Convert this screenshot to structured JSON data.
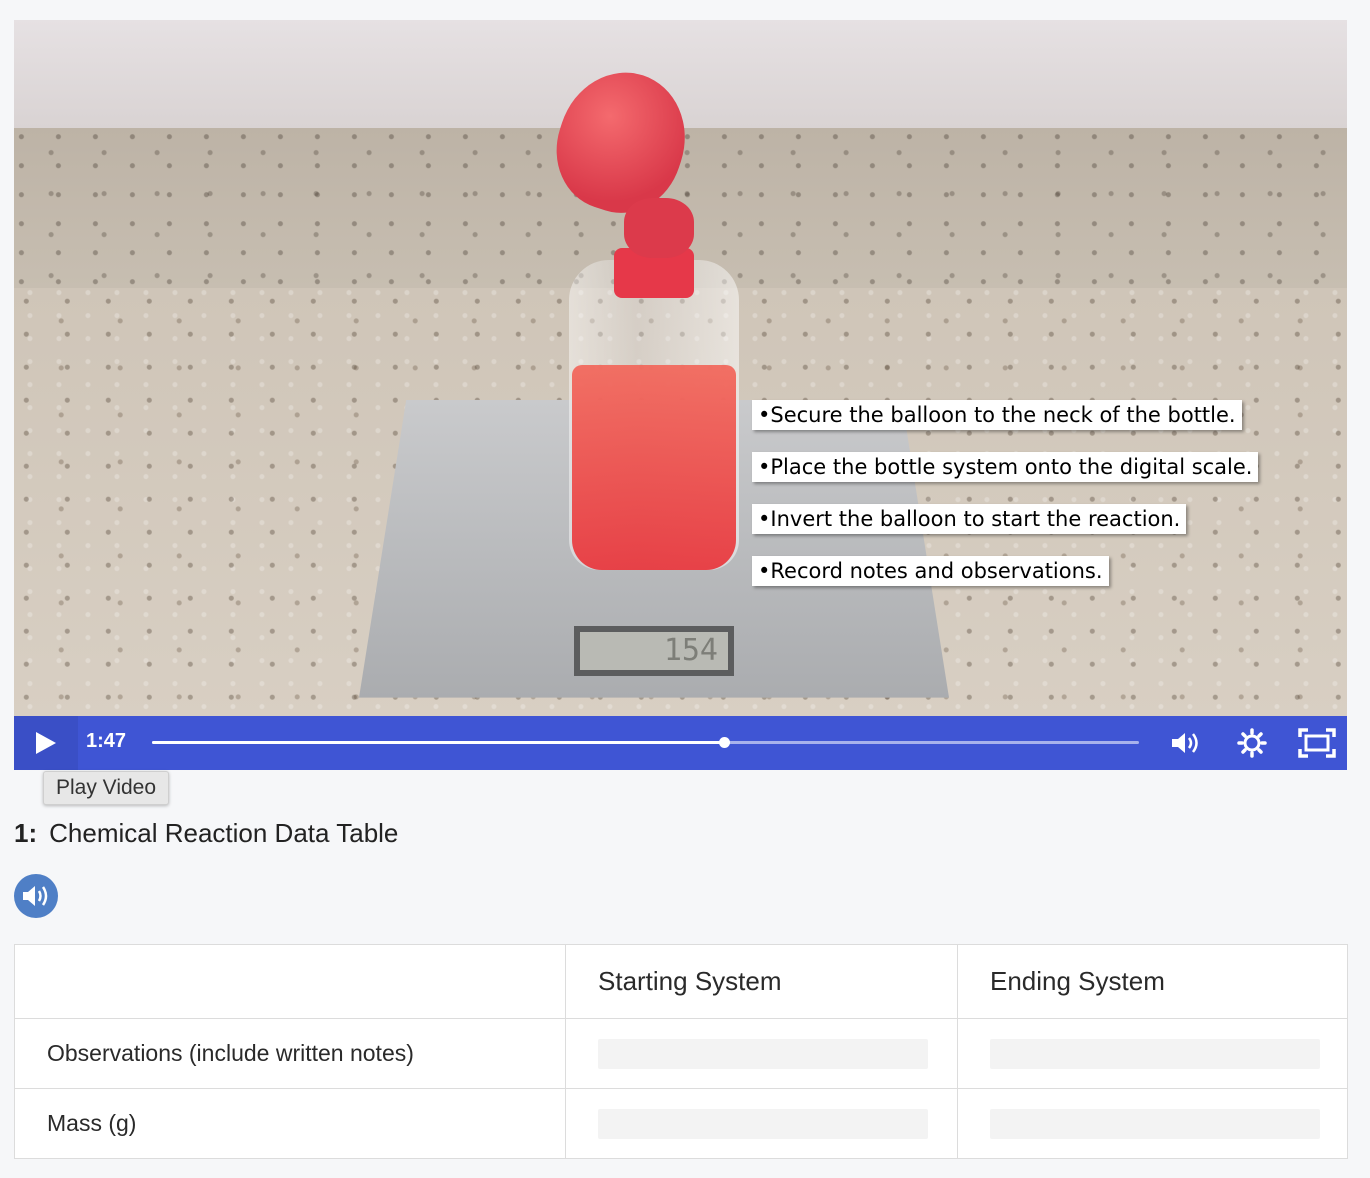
{
  "video": {
    "captions": [
      "•Secure the balloon to the neck of the bottle.",
      "•Place the bottle system onto the digital scale.",
      "•Invert the balloon to start the reaction.",
      "•Record notes and observations."
    ],
    "scale_readout": "154",
    "time": "1:47",
    "progress": 0.58,
    "tooltip": "Play Video",
    "accent_color": "#3f55d4"
  },
  "question": {
    "number": "1:",
    "title": "Chemical Reaction Data Table"
  },
  "table": {
    "headers": [
      "",
      "Starting System",
      "Ending System"
    ],
    "rows": [
      {
        "label": "Observations (include written notes)"
      },
      {
        "label": "Mass (g)"
      }
    ]
  }
}
